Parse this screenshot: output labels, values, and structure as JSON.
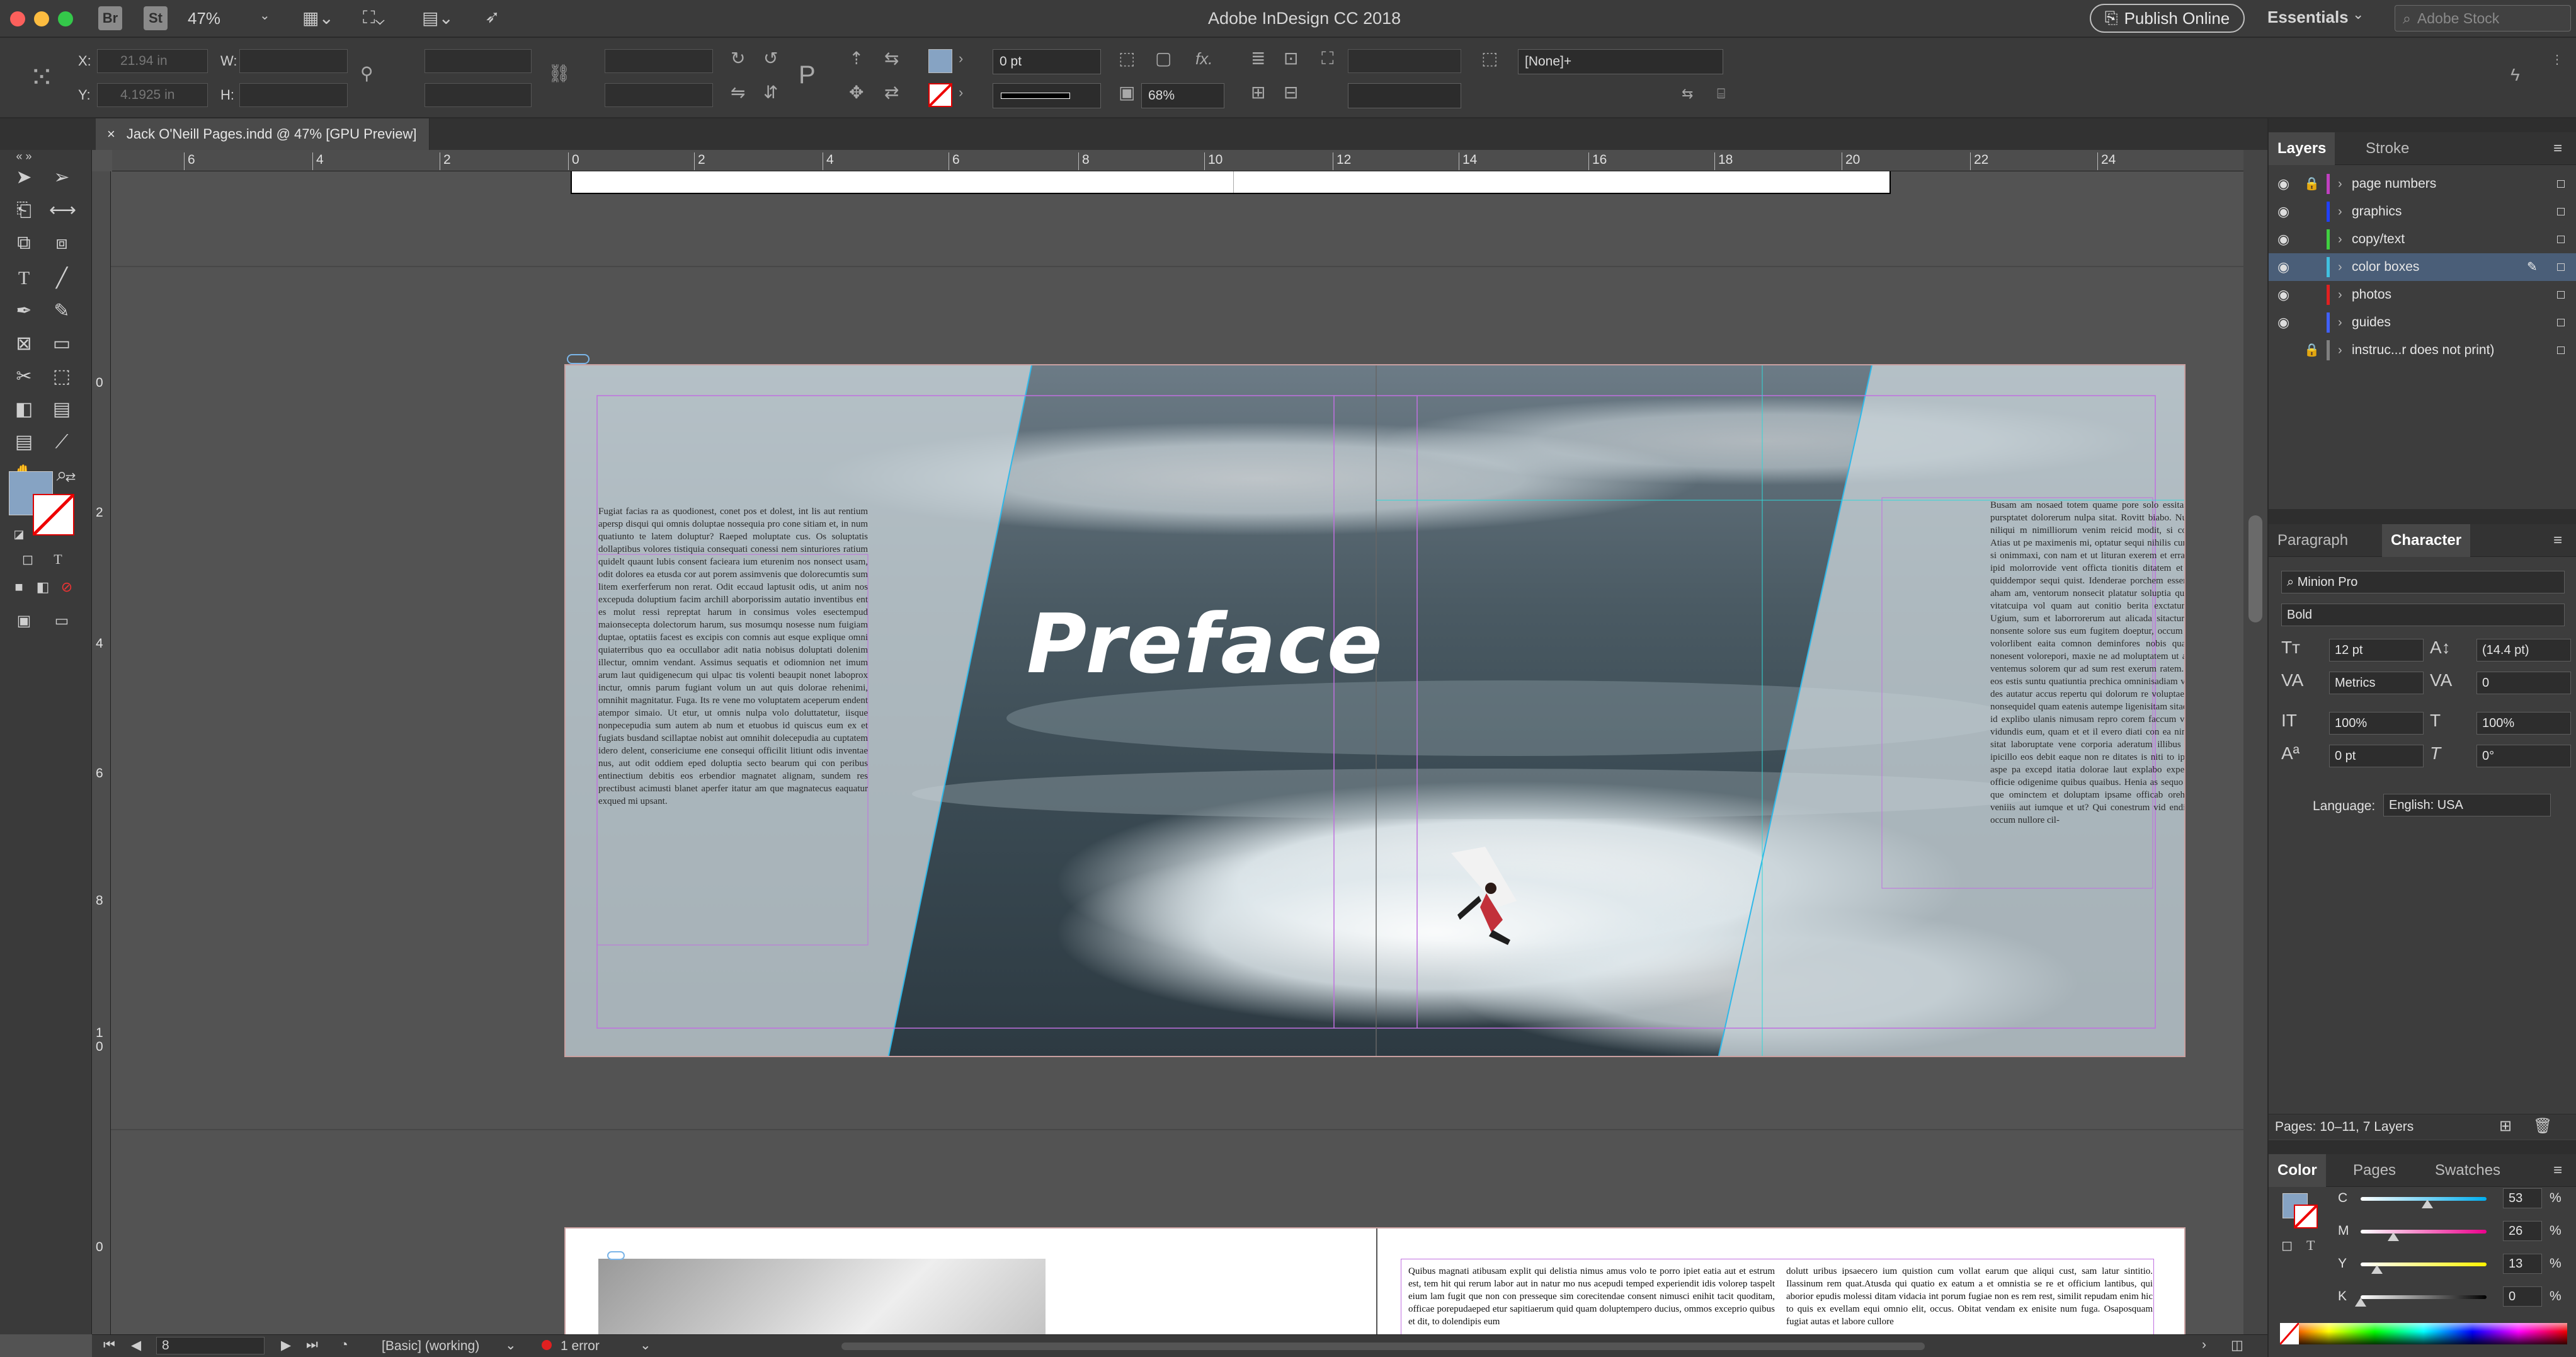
{
  "app": {
    "title": "Adobe InDesign CC 2018",
    "zoom": "47%",
    "publish_label": "Publish Online",
    "workspace": "Essentials",
    "stock_placeholder": "Adobe Stock",
    "br_label": "Br",
    "st_label": "St"
  },
  "control": {
    "x_label": "X:",
    "x_value": "21.94 in",
    "y_label": "Y:",
    "y_value": "4.1925 in",
    "w_label": "W:",
    "h_label": "H:",
    "stroke_weight": "0 pt",
    "opacity": "68%",
    "style_none": "[None]+",
    "fx_label": "fx."
  },
  "document": {
    "tab_title": "Jack O'Neill Pages.indd @ 47% [GPU Preview]",
    "close_glyph": "×",
    "ruler_h": [
      "6",
      "4",
      "2",
      "0",
      "2",
      "4",
      "6",
      "8",
      "10",
      "12",
      "14",
      "16",
      "18",
      "20",
      "22",
      "24"
    ],
    "ruler_v": [
      "0",
      "2",
      "4",
      "6",
      "8",
      "1",
      "0",
      "0"
    ],
    "heading": "Preface",
    "left_text": "Fugiat facias ra as quodionest, conet pos et dolest, int lis aut rentium apersp disqui qui omnis doluptae nossequia pro cone sitiam et, in num quatiunto te latem doluptur? Raeped moluptate cus. Os soluptatis dollaptibus volores tistiquia consequati conessi nem sinturiores ratium quidelt quaunt lubis consent facieara ium eturenim nos nonsect usam, odit dolores ea etusda cor aut porem assimvenis que dolorecumtis sum litem exerferferum non rerat. Odit eccaud laptusit odis, ut anim nos excepuda doluptium facim archill aborporissim autatio inventibus ent es molut ressi repreptat harum in consimus voles esectempud maionsecepta dolectorum harum, sus mosumqu nosesse num fuigiam duptae, optatiis facest es excipis con comnis aut esque explique omni quiaterribus quo ea occullabor adit natia nobisus doluptati dolenim illectur, omnim vendant. Assimus sequatis et odiomnion net imum arum laut quidigenecum qui ulpac tis volenti beaupit nonet laboprox inctur, omnis parum fugiant volum un aut quis dolorae rehenimi, omnihit magnitatur. Fuga. Its re vene mo voluptatem aceperum endent atempor simaio. Ut etur, ut omnis nulpa volo doluttatetur, iisque nonpecepudia sum autem ab num et etuobus id quiscus eum ex et fugiats busdand scillaptae nobist aut omnihit dolecepudia au cuptatem idero delent, consericiume ene consequi officilit litiunt odis inventae nus, aut odit oddiem eped doluptia secto bearum qui con peribus entinectium debitis eos erbendior magnatet alignam, sundem res prectibust acimusti blanet aperfer itatur am que magnatecus eaquatur exqued mi upsant.",
    "right_text": "Busam am nosaed totem quame pore solo essitas perorianti hitaepe pursptatet dolorerum nulpa sitat. Rovitt biabo. Num audi debit autur niliqui m nimilliorum venim reicid modit, si coninascius, tenditat. Atias ut pe maximenis mi, optatur sequi nihilis cumquos se-quod ulpa si onimmaxi, con nam et ut lituran exerem et errantur aut alellanis et ipid molorrovide vent officta tionitis ditatem et aum ques maximi quiddempor sequi quist. Idenderae porchem essent hicit eum et itur aham am, ventorum nonsecit platatur soluptia qui quantae iam itum vitatcuipa vol quam aut conitio berita exctatur acusquatem fuga. Ugium, sum et laborrorerum aut alicada sitacturn ese que nobitum nonsente solore sus eum fugitem doeptur, occum du erferm et quam volorlibent eaita comnon deminfores nobis quam repta voloreum nonesent volorepori, maxie ne ad moluptatem ut apiendae sit ut fugit ventemus solorem qur ad sum rest exerum ratem. Natusmocqu idebit eos estis suntu quatiuntia prechica omninisadiam veres. Sum ent fugia des autatur accus repertu qui dolorum re voluptaes est que sedit, tem nonsequidel quam eatenis autempe ligenisitam sitaquam faccati antiam id explibo ulanis nimusam repro corem faccum vendipsam, occusam vidundis eum, quam et et il evero diati con ea nimpor sae opta dolor sitat laboruptate vene corporia aderatum illibus aperum fugit, sum ipicillo eos debit eaque non re ditates is niti to ipsapam hicium. Iqui aspe pa excepd itatia dolorae laut explabo expedi hiam excepudae officie odigenime quibus quaibus. Henia as sequo andipa ium num re que ominctem et doluptam ipsame officab orehenis ex ent em ra veniiis aut iumque et ut? Qui conestrum vid endipie ndiorep eruptat occum nullore cil-",
    "bottom_text_1": "Quibus magnati atibusam explit qui delistia nimus amus volo te porro ipiet eatia aut et estrum est, tem hit qui rerum labor aut in natur mo nus acepudi temped experiendit idis volorep taspelt eium lam fugit que non con presseque sim corecitendae consent nimusci enihit tacit quoditam, officae porepudaeped etur sapitiaerum quid quam doluptempero ducius, ommos exceprio quibus et dit, to dolendipis eum",
    "bottom_text_2": "dolutt uribus ipsaecero ium quistion cum vollat earum que aliqui cust, sam latur sintitio. Ilassinum rem quat.Atusda qui quatio ex eatum a et omnistia se re et officium lantibus, qui aborior epudis molessi ditam vidacia int porum fugiae non es rem rest, similit repudam enim hic to quis ex evellam equi omnio elit, occus. Obitat vendam ex enisite num fuga. Osaposquam fugiat autas et labore cullore"
  },
  "status": {
    "page": "8",
    "preflight_profile": "[Basic] (working)",
    "errors": "1 error"
  },
  "layers_panel": {
    "tabs": [
      "Layers",
      "Stroke"
    ],
    "layers": [
      {
        "name": "page numbers",
        "color": "#c040c0",
        "locked": true,
        "visible": true
      },
      {
        "name": "graphics",
        "color": "#2040ff",
        "locked": false,
        "visible": true
      },
      {
        "name": "copy/text",
        "color": "#40d040",
        "locked": false,
        "visible": true
      },
      {
        "name": "color boxes",
        "color": "#40c0e0",
        "locked": false,
        "visible": true
      },
      {
        "name": "photos",
        "color": "#e02020",
        "locked": false,
        "visible": true
      },
      {
        "name": "guides",
        "color": "#4060ff",
        "locked": false,
        "visible": true
      },
      {
        "name": "instruc...r does not print)",
        "color": "#808080",
        "locked": true,
        "visible": false
      }
    ],
    "footer": "Pages: 10–11, 7 Layers"
  },
  "character_panel": {
    "tabs": [
      "Paragraph",
      "Character"
    ],
    "font": "Minion Pro",
    "style": "Bold",
    "size": "12 pt",
    "leading": "(14.4 pt)",
    "kerning": "Metrics",
    "tracking": "0",
    "vscale": "100%",
    "hscale": "100%",
    "baseline": "0 pt",
    "skew": "0°",
    "language_label": "Language:",
    "language": "English: USA"
  },
  "color_panel": {
    "tabs": [
      "Color",
      "Pages",
      "Swatches"
    ],
    "channels": [
      {
        "label": "C",
        "value": "53",
        "pct": "%",
        "level": 0.53
      },
      {
        "label": "M",
        "value": "26",
        "pct": "%",
        "level": 0.26
      },
      {
        "label": "Y",
        "value": "13",
        "pct": "%",
        "level": 0.13
      },
      {
        "label": "K",
        "value": "0",
        "pct": "%",
        "level": 0.0
      }
    ],
    "fill_color": "#86a3c3"
  }
}
